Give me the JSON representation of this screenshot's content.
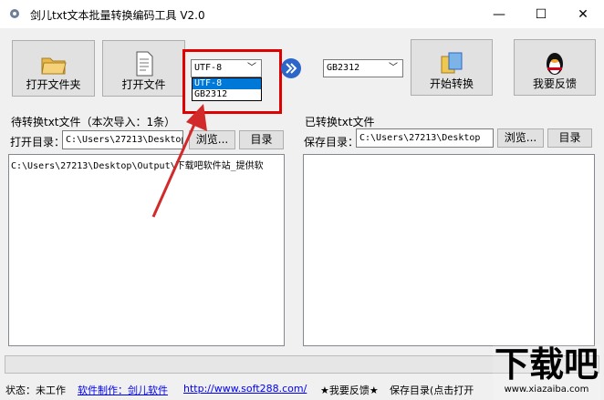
{
  "window": {
    "title": "剑儿txt文本批量转换编码工具 V2.0",
    "controls": [
      "—",
      "☐",
      "✕"
    ]
  },
  "toolbar": {
    "open_folder": "打开文件夹",
    "open_file": "打开文件",
    "start_convert": "开始转换",
    "feedback": "我要反馈"
  },
  "source_encoding": {
    "value": "UTF-8",
    "options": [
      "UTF-8",
      "GB2312"
    ]
  },
  "target_encoding": {
    "value": "GB2312"
  },
  "left_panel": {
    "title": "待转换txt文件（本次导入：1条）",
    "dir_label": "打开目录：",
    "dir_value": "C:\\Users\\27213\\Desktop",
    "browse": "浏览...",
    "dir_button": "目录",
    "files": [
      "C:\\Users\\27213\\Desktop\\Output\\下载吧软件站_提供软"
    ]
  },
  "right_panel": {
    "title": "已转换txt文件",
    "dir_label": "保存目录：",
    "dir_value": "C:\\Users\\27213\\Desktop",
    "browse": "浏览...",
    "dir_button": "目录"
  },
  "status": {
    "state": "状态：未工作",
    "author": "软件制作：剑儿软件",
    "url": "http://www.soft288.com/",
    "feedback": "★我要反馈★",
    "save_dir": "保存目录(点击打开"
  },
  "watermark": {
    "text": "下载吧",
    "url": "www.xiazaiba.com"
  },
  "colors": {
    "highlight": "#e00000",
    "arrow": "#d22a2a",
    "selection": "#0078d7"
  }
}
